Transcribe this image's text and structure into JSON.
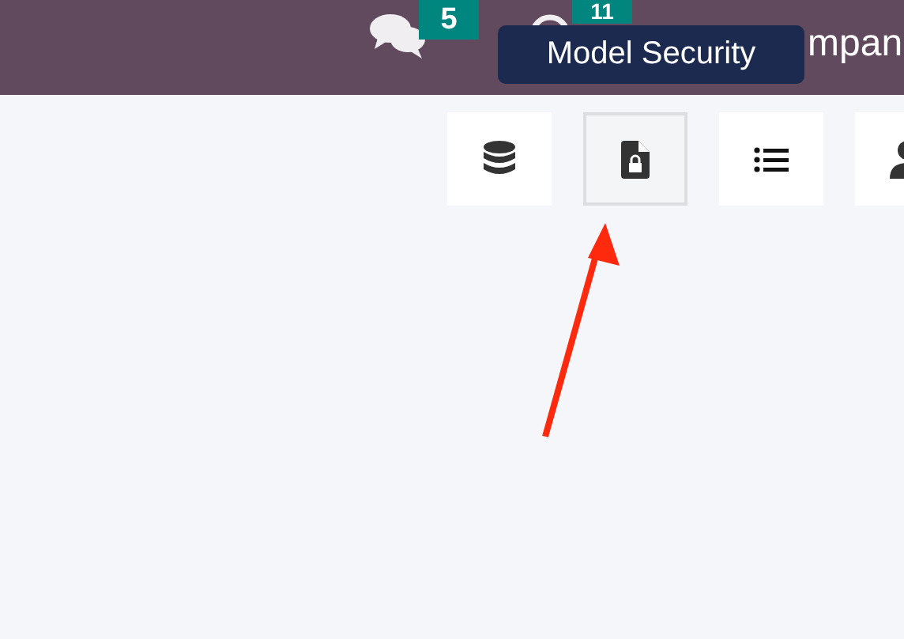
{
  "top_bar": {
    "messages_badge": "5",
    "activities_badge": "11",
    "company": "mpan"
  },
  "tooltip": "Model Security",
  "buttons": [
    {
      "kind": "database",
      "selected": false
    },
    {
      "kind": "document-lock",
      "selected": true
    },
    {
      "kind": "list",
      "selected": false
    },
    {
      "kind": "user",
      "selected": false
    }
  ]
}
